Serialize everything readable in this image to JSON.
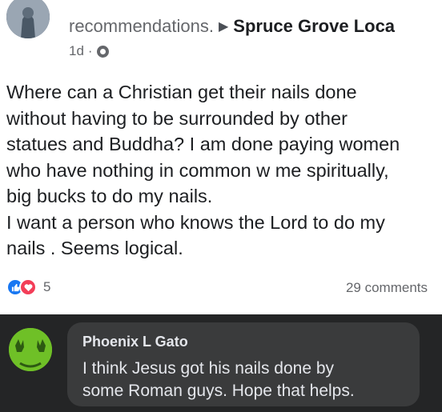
{
  "post": {
    "header_prefix": "recommendations.",
    "group_name": "Spruce Grove Loca",
    "time": "1d",
    "separator": "·",
    "body_lines": [
      "Where can a Christian get their nails done",
      "without having to be surrounded by other",
      "statues and Buddha? I am done paying women",
      "who have nothing in common w me  spiritually,",
      "big bucks to do my nails.",
      "I want a person who knows the Lord to do my",
      "nails . Seems logical."
    ],
    "reaction_count": "5",
    "comments_label": "29 comments"
  },
  "icons": {
    "like": "thumbs-up-icon",
    "love": "heart-icon",
    "privacy": "globe-icon",
    "arrow": "triangle-right-icon"
  },
  "comment": {
    "author": "Phoenix L Gato",
    "text_lines": [
      "I think Jesus got his nails done by",
      "some Roman guys. Hope that helps."
    ]
  },
  "colors": {
    "like_blue": "#1877f2",
    "love_red": "#f33e58",
    "comment_bg": "#242526",
    "bubble_bg": "#3a3b3c",
    "avatar_green": "#6fc027"
  }
}
